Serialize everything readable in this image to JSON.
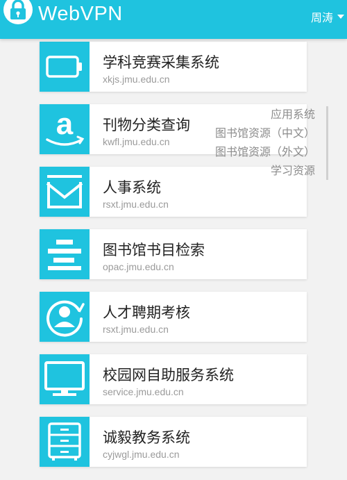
{
  "header": {
    "app_name": "WebVPN",
    "user_name": "周涛"
  },
  "apps": [
    {
      "name": "学科竞赛采集系统",
      "url": "xkjs.jmu.edu.cn",
      "icon": "battery-icon"
    },
    {
      "name": "刊物分类查询",
      "url": "kwfl.jmu.edu.cn",
      "icon": "amazon-icon"
    },
    {
      "name": "人事系统",
      "url": "rsxt.jmu.edu.cn",
      "icon": "mail-icon"
    },
    {
      "name": "图书馆书目检索",
      "url": "opac.jmu.edu.cn",
      "icon": "stack-icon"
    },
    {
      "name": "人才聘期考核",
      "url": "rsxt.jmu.edu.cn",
      "icon": "user-refresh-icon"
    },
    {
      "name": "校园网自助服务系统",
      "url": "service.jmu.edu.cn",
      "icon": "monitor-icon"
    },
    {
      "name": "诚毅教务系统",
      "url": "cyjwgl.jmu.edu.cn",
      "icon": "cabinet-icon"
    }
  ],
  "category_menu": {
    "items": [
      "应用系统",
      "图书馆资源（中文）",
      "图书馆资源（外文）",
      "学习资源"
    ]
  },
  "colors": {
    "accent": "#1fc3df",
    "card_bg": "#ffffff",
    "page_bg": "#f2f2f2"
  }
}
